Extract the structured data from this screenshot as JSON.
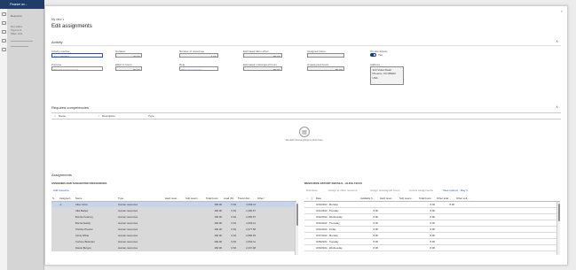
{
  "background": {
    "app_title": "Finance an...",
    "nav_labels": [
      "Resource",
      "Not starte",
      "Type to fi",
      "Filter: Acti"
    ]
  },
  "panel": {
    "my_view": "My view ∨",
    "title": "Edit assignments",
    "close": "×"
  },
  "activity": {
    "section_title": "Activity",
    "fields": {
      "activity_number": {
        "label": "Activity number",
        "value": "ACU-000004"
      },
      "purpose": {
        "label": "Purpose",
        "value": "Project management"
      },
      "duration": {
        "label": "Duration",
        "value": "20.00"
      },
      "effort_in_hours": {
        "label": "Effort in hours",
        "value": "80.00"
      },
      "number_of_resources": {
        "label": "Number of resources",
        "value": "1.00"
      },
      "role": {
        "label": "Role",
        "value": "Project manager"
      },
      "estimated_labor_effort": {
        "label": "Estimated labor effort",
        "value": "80.00"
      },
      "estimated_unassigned_hours": {
        "label": "Estimated unassigned hours",
        "value": "80.00"
      },
      "assigned_hours": {
        "label": "Assigned hours",
        "value": ""
      },
      "unassigned_hours": {
        "label": "Unassigned hours",
        "value": "80.00"
      },
      "onsite_activity": {
        "label": "On-site activity",
        "value": "Yes"
      },
      "address": {
        "label": "Address",
        "lines": [
          "123 Violet Road",
          "Phoenix, CO 85003",
          "USA"
        ]
      }
    }
  },
  "competencies": {
    "section_title": "Required competencies",
    "columns": [
      "Name",
      "Description",
      "Type"
    ],
    "empty_text": "We didn't find anything to show here."
  },
  "assignments": {
    "section_title": "Assignments",
    "left": {
      "subhead": "ASSIGNED AND SUGGESTED RESOURCES",
      "add_resource": "Add resource",
      "columns": [
        "S...",
        "Assigned ↓",
        "Name",
        "Type",
        "Hard reser...",
        "Soft reserv...",
        "Total hours",
        "Load (%)",
        "Travel dist...",
        "Other ↑"
      ],
      "rows": [
        {
          "name": "Alice Ciccu",
          "type": "Human resources",
          "total": "160.00",
          "load": "0.63",
          "travel": "2,252.11"
        },
        {
          "name": "Allie Bellew",
          "type": "Human resources",
          "total": "160.00",
          "load": "0.63",
          "travel": "2,269.67"
        },
        {
          "name": "Bonnie Kearney",
          "type": "Human resources",
          "total": "160.00",
          "load": "0.63",
          "travel": "2,269.67"
        },
        {
          "name": "Bonnie Easily",
          "type": "Human resources",
          "total": "160.00",
          "load": "0.63",
          "travel": "2,252.11"
        },
        {
          "name": "Christie Preston",
          "type": "Human resources",
          "total": "160.00",
          "load": "0.63",
          "travel": "2,277.58"
        },
        {
          "name": "Cindy White",
          "type": "Human resources",
          "total": "160.00",
          "load": "0.63",
          "travel": "2,566.93"
        },
        {
          "name": "Corinne Bolander",
          "type": "Human resources",
          "total": "160.00",
          "load": "0.63",
          "travel": "2,252.11"
        },
        {
          "name": "Daniel Burgos",
          "type": "Human resources",
          "total": "160.00",
          "load": "0.63",
          "travel": "2,247.48"
        }
      ]
    },
    "right": {
      "subhead": "RESOURCE EFFORT DETAILS - ALICE CICCU",
      "toolbar": [
        "Distribute",
        "Assign to other resource",
        "Assign unassigned hours",
        "Cancel assignments",
        "View options"
      ],
      "view_options_value": "Day ∨",
      "columns": [
        "Date",
        "Available h...",
        "Hard reser...",
        "Soft reserv...",
        "Total hours",
        "Other total...",
        "Other soft..."
      ],
      "rows": [
        {
          "date": "3/20/2022 - Monday",
          "avail": "",
          "total": "8.00",
          "other_total": "8.00"
        },
        {
          "date": "3/21/2022 - Tuesday",
          "avail": "8.00",
          "total": "8.00",
          "other_total": ""
        },
        {
          "date": "3/22/2022 - Wednesday",
          "avail": "8.00",
          "total": "8.00",
          "other_total": ""
        },
        {
          "date": "3/23/2022 - Thursday",
          "avail": "8.00",
          "total": "8.00",
          "other_total": ""
        },
        {
          "date": "3/24/2022 - Friday",
          "avail": "8.00",
          "total": "8.00",
          "other_total": ""
        },
        {
          "date": "3/27/2022 - Monday",
          "avail": "8.00",
          "total": "8.00",
          "other_total": ""
        },
        {
          "date": "3/28/2022 - Tuesday",
          "avail": "8.00",
          "total": "8.00",
          "other_total": ""
        },
        {
          "date": "3/29/2022 - Wednesday",
          "avail": "8.00",
          "total": "8.00",
          "other_total": ""
        }
      ]
    }
  },
  "colors": {
    "accent": "#1f4fbf",
    "nav_bar": "#1f3d68",
    "selected_row": "#c7d5ea"
  }
}
